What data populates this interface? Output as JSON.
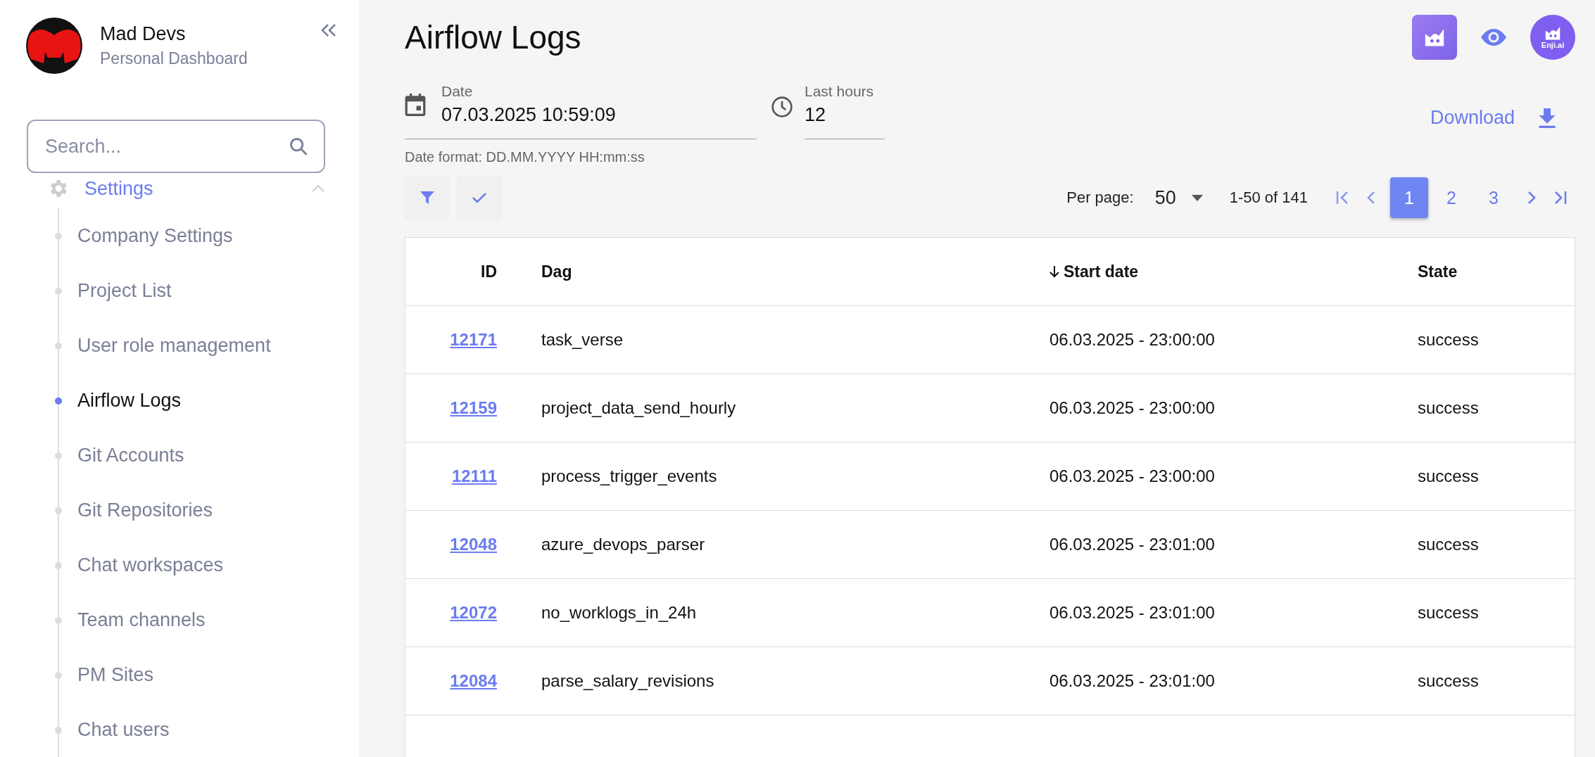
{
  "org": {
    "name": "Mad Devs",
    "subtitle": "Personal Dashboard"
  },
  "search": {
    "placeholder": "Search..."
  },
  "nav_group": {
    "label": "Settings",
    "expanded": true,
    "items": [
      {
        "label": "Company Settings",
        "selected": false
      },
      {
        "label": "Project List",
        "selected": false
      },
      {
        "label": "User role management",
        "selected": false
      },
      {
        "label": "Airflow Logs",
        "selected": true
      },
      {
        "label": "Git Accounts",
        "selected": false
      },
      {
        "label": "Git Repositories",
        "selected": false
      },
      {
        "label": "Chat workspaces",
        "selected": false
      },
      {
        "label": "Team channels",
        "selected": false
      },
      {
        "label": "PM Sites",
        "selected": false
      },
      {
        "label": "Chat users",
        "selected": false
      }
    ]
  },
  "page_title": "Airflow Logs",
  "avatar_badge": "Enji.ai",
  "date_field": {
    "label": "Date",
    "value": "07.03.2025 10:59:09",
    "hint": "Date format: DD.MM.YYYY HH:mm:ss"
  },
  "hours_field": {
    "label": "Last hours",
    "value": "12"
  },
  "download": "Download",
  "pagination": {
    "per_page_label": "Per page:",
    "per_page": "50",
    "range": "1-50 of 141",
    "pages": [
      {
        "label": "1",
        "selected": true
      },
      {
        "label": "2",
        "selected": false
      },
      {
        "label": "3",
        "selected": false
      }
    ]
  },
  "table": {
    "columns": [
      {
        "label": "ID",
        "sorted": false
      },
      {
        "label": "Dag",
        "sorted": false
      },
      {
        "label": "Start date",
        "sorted": true
      },
      {
        "label": "State",
        "sorted": false
      }
    ],
    "rows": [
      [
        "12171",
        "task_verse",
        "06.03.2025 - 23:00:00",
        "success"
      ],
      [
        "12159",
        "project_data_send_hourly",
        "06.03.2025 - 23:00:00",
        "success"
      ],
      [
        "12111",
        "process_trigger_events",
        "06.03.2025 - 23:00:00",
        "success"
      ],
      [
        "12048",
        "azure_devops_parser",
        "06.03.2025 - 23:01:00",
        "success"
      ],
      [
        "12072",
        "no_worklogs_in_24h",
        "06.03.2025 - 23:01:00",
        "success"
      ],
      [
        "12084",
        "parse_salary_revisions",
        "06.03.2025 - 23:01:00",
        "success"
      ]
    ]
  }
}
